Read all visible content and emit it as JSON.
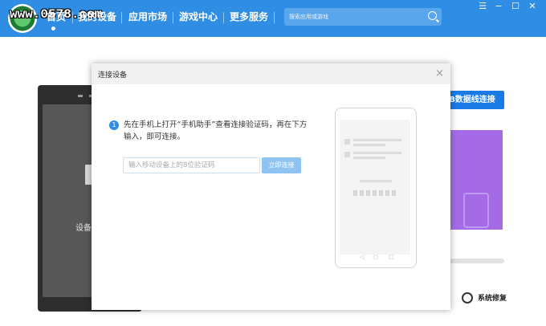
{
  "watermark": "www.0578.com",
  "nav": {
    "items": [
      "首页",
      "我的设备",
      "应用市场",
      "游戏中心",
      "更多服务"
    ]
  },
  "search": {
    "placeholder": "搜索应用或游戏"
  },
  "window_controls": {
    "menu": "☰",
    "minimize": "−",
    "maximize": "☐",
    "close": "✕"
  },
  "background": {
    "device_text": "设备",
    "usb_button": "B数据线连接",
    "repair_label": "系统修复"
  },
  "dialog": {
    "title": "连接设备",
    "close": "×",
    "step_number": "1",
    "instruction": "先在手机上打开“手机助手”查看连接验证码，再在下方输入，即可连接。",
    "code_placeholder": "输入移动设备上的8位验证码",
    "code_value": "",
    "connect_button": "立即连接",
    "phone_nav": [
      "◁",
      "○",
      "□"
    ]
  },
  "colors": {
    "topbar": "#2f8de4",
    "accent": "#1a7be6",
    "connect_btn": "#8fc4f2"
  },
  "icons": [
    "logo-icon",
    "search-icon",
    "menu-icon",
    "minimize-icon",
    "maximize-icon",
    "window-close-icon",
    "close-icon",
    "gear-icon",
    "phone-illustration-icon"
  ]
}
